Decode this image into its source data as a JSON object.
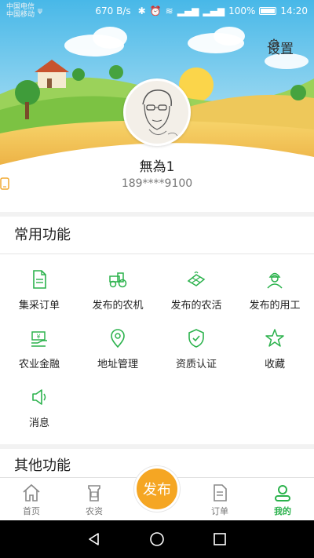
{
  "status_bar": {
    "carrier1": "中国电信",
    "carrier2": "中国移动",
    "speed": "670 B/s",
    "battery": "100%",
    "time": "14:20"
  },
  "header": {
    "settings_label": "设置",
    "username": "無為1",
    "phone": "189****9100"
  },
  "common": {
    "title": "常用功能",
    "items": [
      {
        "label": "集采订单",
        "icon": "document-icon"
      },
      {
        "label": "发布的农机",
        "icon": "tractor-icon"
      },
      {
        "label": "发布的农活",
        "icon": "farmland-icon"
      },
      {
        "label": "发布的用工",
        "icon": "worker-icon"
      },
      {
        "label": "农业金融",
        "icon": "money-icon"
      },
      {
        "label": "地址管理",
        "icon": "location-icon"
      },
      {
        "label": "资质认证",
        "icon": "shield-check-icon"
      },
      {
        "label": "收藏",
        "icon": "star-icon"
      },
      {
        "label": "消息",
        "icon": "speaker-icon"
      }
    ]
  },
  "other": {
    "title": "其他功能"
  },
  "tabbar": {
    "home": "首页",
    "supplies": "农资",
    "publish": "发布",
    "orders": "订单",
    "mine": "我的"
  },
  "colors": {
    "accent": "#2bb24c",
    "publish": "#f5a623"
  }
}
